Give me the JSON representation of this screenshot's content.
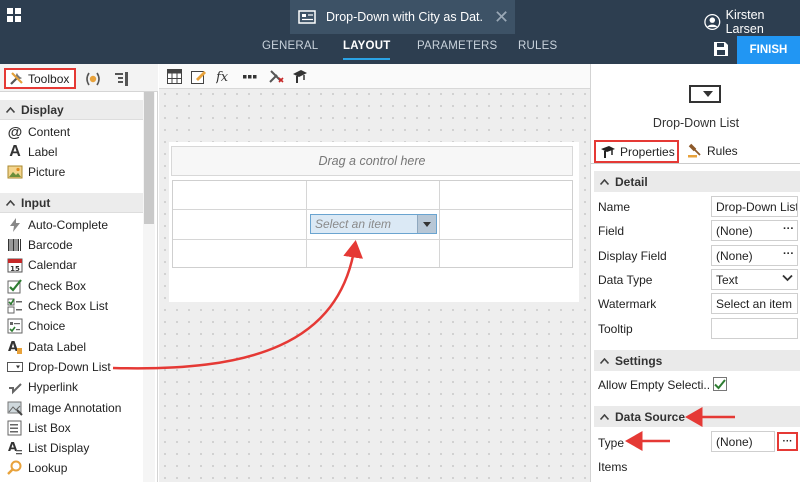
{
  "header": {
    "form_title": "Drop-Down with City as Dat...",
    "user_name": "Kirsten Larsen",
    "nav_tabs": [
      "GENERAL",
      "LAYOUT",
      "PARAMETERS",
      "RULES"
    ],
    "active_tab": "LAYOUT",
    "finish_label": "FINISH"
  },
  "toolbox": {
    "tab_label": "Toolbox",
    "sections": {
      "display": {
        "title": "Display",
        "items": [
          {
            "label": "Content",
            "icon": "at-sign-icon"
          },
          {
            "label": "Label",
            "icon": "label-a-icon"
          },
          {
            "label": "Picture",
            "icon": "picture-icon"
          }
        ]
      },
      "input": {
        "title": "Input",
        "items": [
          {
            "label": "Auto-Complete",
            "icon": "lightning-icon"
          },
          {
            "label": "Barcode",
            "icon": "barcode-icon"
          },
          {
            "label": "Calendar",
            "icon": "calendar-icon"
          },
          {
            "label": "Check Box",
            "icon": "checkbox-icon"
          },
          {
            "label": "Check Box List",
            "icon": "checkbox-list-icon"
          },
          {
            "label": "Choice",
            "icon": "choice-icon"
          },
          {
            "label": "Data Label",
            "icon": "data-label-icon"
          },
          {
            "label": "Drop-Down List",
            "icon": "dropdown-icon"
          },
          {
            "label": "Hyperlink",
            "icon": "hyperlink-icon"
          },
          {
            "label": "Image Annotation",
            "icon": "image-annotation-icon"
          },
          {
            "label": "List Box",
            "icon": "list-box-icon"
          },
          {
            "label": "List Display",
            "icon": "list-display-icon"
          },
          {
            "label": "Lookup",
            "icon": "lookup-icon"
          }
        ]
      }
    }
  },
  "canvas": {
    "drag_hint": "Drag a control here",
    "dropdown_placeholder": "Select an item"
  },
  "properties": {
    "control_name": "Drop-Down List",
    "tabs": {
      "properties": "Properties",
      "rules": "Rules"
    },
    "detail": {
      "title": "Detail",
      "rows": [
        {
          "label": "Name",
          "value": "Drop-Down List"
        },
        {
          "label": "Field",
          "value": "(None)"
        },
        {
          "label": "Display Field",
          "value": "(None)"
        },
        {
          "label": "Data Type",
          "value": "Text"
        },
        {
          "label": "Watermark",
          "value": "Select an item"
        },
        {
          "label": "Tooltip",
          "value": ""
        }
      ]
    },
    "settings": {
      "title": "Settings",
      "allow_empty_label": "Allow Empty Selecti...",
      "allow_empty_checked": true
    },
    "data_source": {
      "title": "Data Source",
      "type_label": "Type",
      "type_value": "(None)",
      "items_label": "Items"
    }
  },
  "colors": {
    "header_bg": "#2d3e50",
    "accent": "#2196f3",
    "annotation": "#e53935"
  }
}
